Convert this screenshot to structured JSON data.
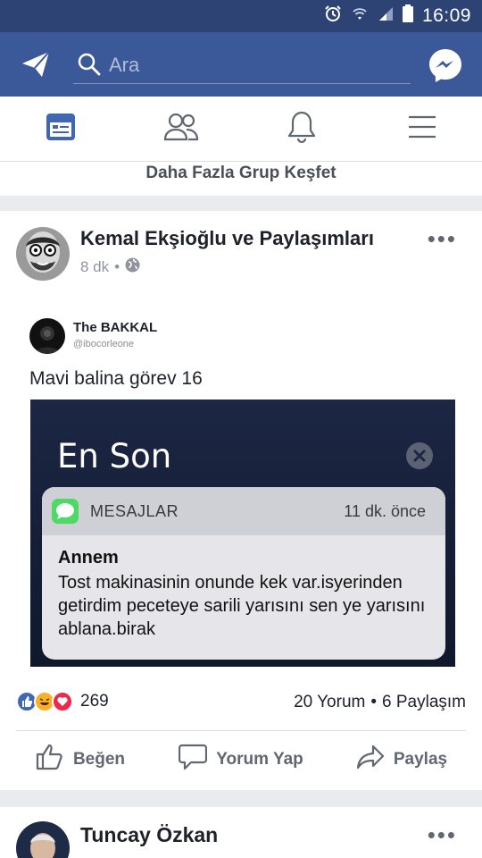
{
  "status_bar": {
    "time": "16:09"
  },
  "search": {
    "placeholder": "Ara"
  },
  "discover": {
    "label": "Daha Fazla Grup Keşfet"
  },
  "post": {
    "author": "Kemal Ekşioğlu ve Paylaşımları",
    "time": "8 dk",
    "separator": "•",
    "embedded": {
      "name": "The BAKKAL",
      "handle": "@ibocorleone",
      "text": "Mavi balina görev 16",
      "screenshot": {
        "title": "En Son",
        "app_name": "MESAJLAR",
        "time": "11 dk. önce",
        "sender": "Annem",
        "message": "Tost makinasinin onunde kek var.isyerinden getirdim peceteye sarili yarısını sen ye yarısını ablana.birak"
      }
    },
    "reaction_count": "269",
    "comments": "20 Yorum",
    "dot": "•",
    "shares": "6 Paylaşım",
    "actions": {
      "like": "Beğen",
      "comment": "Yorum Yap",
      "share": "Paylaş"
    }
  },
  "next_post": {
    "author": "Tuncay Özkan"
  },
  "colors": {
    "brand": "#3b5998",
    "status_bar": "#2d4373",
    "active_tab": "#4267b2"
  }
}
